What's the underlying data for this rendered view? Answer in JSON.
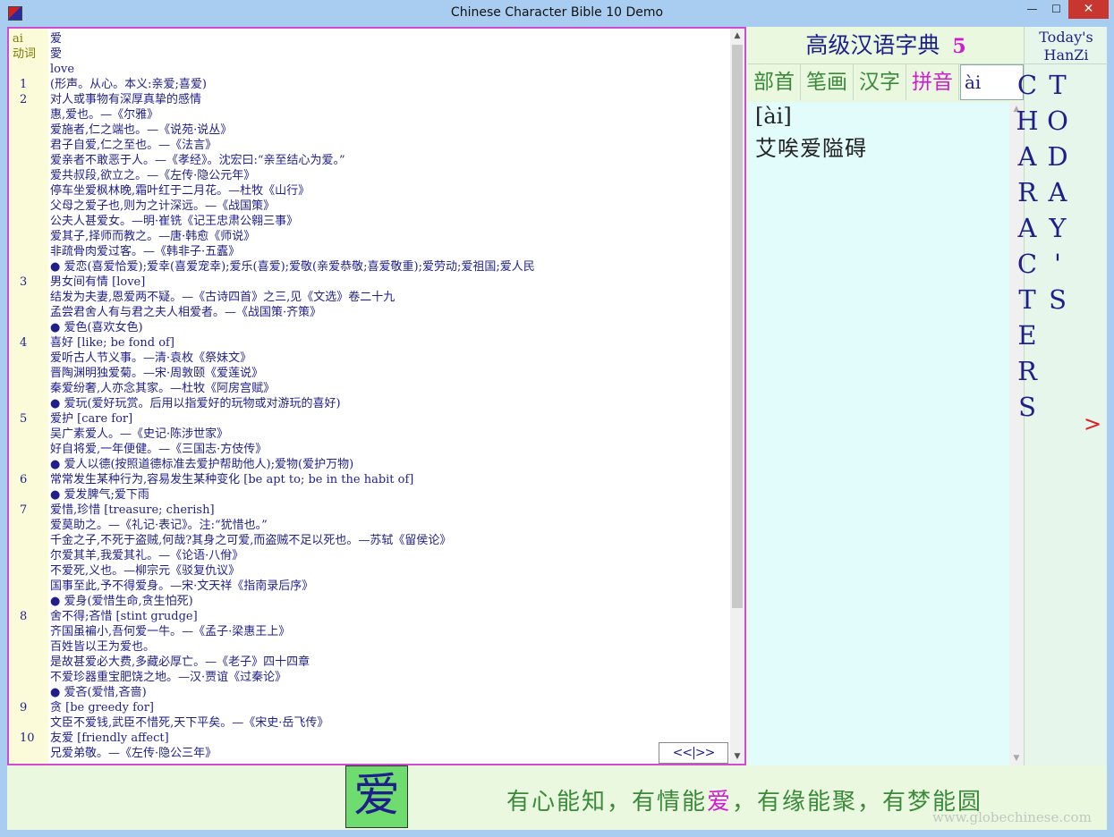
{
  "window": {
    "title": "Chinese Character Bible   10    Demo",
    "min_glyph": "—",
    "max_glyph": "☐",
    "close_glyph": "✕"
  },
  "entry": {
    "lines": [
      {
        "n": "ai",
        "t": "爱"
      },
      {
        "n": "动词",
        "t": "愛"
      },
      {
        "n": "",
        "t": "love"
      },
      {
        "n": "1",
        "t": "(形声。从心。本义:亲爱;喜爱)"
      },
      {
        "n": "2",
        "t": "对人或事物有深厚真挚的感情"
      },
      {
        "n": "",
        "t": "惠,爱也。—《尔雅》"
      },
      {
        "n": "",
        "t": "爱施者,仁之端也。—《说苑·说丛》"
      },
      {
        "n": "",
        "t": "君子自爱,仁之至也。—《法言》"
      },
      {
        "n": "",
        "t": "爱亲者不敢恶于人。—《孝经》。沈宏曰:“亲至结心为爱。”"
      },
      {
        "n": "",
        "t": "爱共叔段,欲立之。—《左传·隐公元年》"
      },
      {
        "n": "",
        "t": "停车坐爱枫林晚,霜叶红于二月花。—杜牧《山行》"
      },
      {
        "n": "",
        "t": "父母之爱子也,则为之计深远。—《战国策》"
      },
      {
        "n": "",
        "t": "公夫人甚爱女。—明·崔铣《记王忠肃公翱三事》"
      },
      {
        "n": "",
        "t": "爱其子,择师而教之。—唐·韩愈《师说》"
      },
      {
        "n": "",
        "t": "非疏骨肉爱过客。—《韩非子·五蠹》"
      },
      {
        "n": "",
        "t": "● 爱恋(喜爱恰爱);爱幸(喜爱宠幸);爱乐(喜爱);爱敬(亲爱恭敬;喜爱敬重);爱劳动;爱祖国;爱人民"
      },
      {
        "n": "3",
        "t": "男女间有情 [love]"
      },
      {
        "n": "",
        "t": "结发为夫妻,恩爱两不疑。—《古诗四首》之三,见《文选》卷二十九"
      },
      {
        "n": "",
        "t": "孟尝君舍人有与君之夫人相爱者。—《战国策·齐策》"
      },
      {
        "n": "",
        "t": "● 爱色(喜欢女色)"
      },
      {
        "n": "4",
        "t": "喜好 [like; be fond of]"
      },
      {
        "n": "",
        "t": "爱听古人节义事。—清·袁枚《祭妹文》"
      },
      {
        "n": "",
        "t": "晋陶渊明独爱菊。—宋·周敦颐《爱莲说》"
      },
      {
        "n": "",
        "t": "秦爱纷奢,人亦念其家。—杜牧《阿房宫赋》"
      },
      {
        "n": "",
        "t": "● 爱玩(爱好玩赏。后用以指爱好的玩物或对游玩的喜好)"
      },
      {
        "n": "5",
        "t": "爱护 [care for]"
      },
      {
        "n": "",
        "t": "吴广素爱人。—《史记·陈涉世家》"
      },
      {
        "n": "",
        "t": "好自将爱,一年便健。—《三国志·方伎传》"
      },
      {
        "n": "",
        "t": "● 爱人以德(按照道德标准去爱护帮助他人);爱物(爱护万物)"
      },
      {
        "n": "6",
        "t": "常常发生某种行为,容易发生某种变化 [be apt to; be in the habit of]"
      },
      {
        "n": "",
        "t": "● 爱发脾气;爱下雨"
      },
      {
        "n": "7",
        "t": "爱惜,珍惜 [treasure; cherish]"
      },
      {
        "n": "",
        "t": "爱莫助之。—《礼记·表记》。注:“犹惜也。”"
      },
      {
        "n": "",
        "t": "千金之子,不死于盗贼,何哉?其身之可爱,而盗贼不足以死也。—苏轼《留侯论》"
      },
      {
        "n": "",
        "t": "尔爱其羊,我爱其礼。—《论语·八佾》"
      },
      {
        "n": "",
        "t": "不爱死,义也。—柳宗元《驳复仇议》"
      },
      {
        "n": "",
        "t": "国事至此,予不得爱身。—宋·文天祥《指南录后序》"
      },
      {
        "n": "",
        "t": "● 爱身(爱惜生命,贪生怕死)"
      },
      {
        "n": "8",
        "t": "舍不得;吝惜 [stint grudge]"
      },
      {
        "n": "",
        "t": "齐国虽褊小,吾何爱一牛。—《孟子·梁惠王上》"
      },
      {
        "n": "",
        "t": "百姓皆以王为爱也。"
      },
      {
        "n": "",
        "t": "是故甚爱必大费,多藏必厚亡。—《老子》四十四章"
      },
      {
        "n": "",
        "t": "不爱珍器重宝肥饶之地。—汉·贾谊《过秦论》"
      },
      {
        "n": "",
        "t": "● 爱吝(爱惜,吝啬)"
      },
      {
        "n": "9",
        "t": "贪 [be greedy for]"
      },
      {
        "n": "",
        "t": "文臣不爱钱,武臣不惜死,天下平矣。—《宋史·岳飞传》"
      },
      {
        "n": "10",
        "t": "友爱 [friendly affect]"
      },
      {
        "n": "",
        "t": "兄爱弟敬。—《左传·隐公三年》"
      }
    ],
    "pager": "<<|>>"
  },
  "dictionary": {
    "title": "高级汉语字典",
    "edition": "5"
  },
  "search_tabs": {
    "radical": "部首",
    "strokes": "笔画",
    "hanzi": "汉字",
    "pinyin": "拼音",
    "input_value": "ài"
  },
  "result": {
    "pinyin": "[ài]",
    "characters": "艾唉爱隘碍"
  },
  "today": {
    "header": "Today's HanZi",
    "vertical": "TODAY'S CHARACTERS",
    "arrow": ">"
  },
  "bottom": {
    "big_char": "爱",
    "motto_pre": "有心能知，有情能",
    "motto_love": "爱",
    "motto_post": "，有缘能聚，有梦能圆",
    "site": "www.globechinese.com"
  },
  "colors": {
    "accent_magenta": "#d14bd1",
    "text_navy": "#1f1f8c",
    "motto_green": "#3a8a3a",
    "highlight_green": "#6fdc6f"
  }
}
